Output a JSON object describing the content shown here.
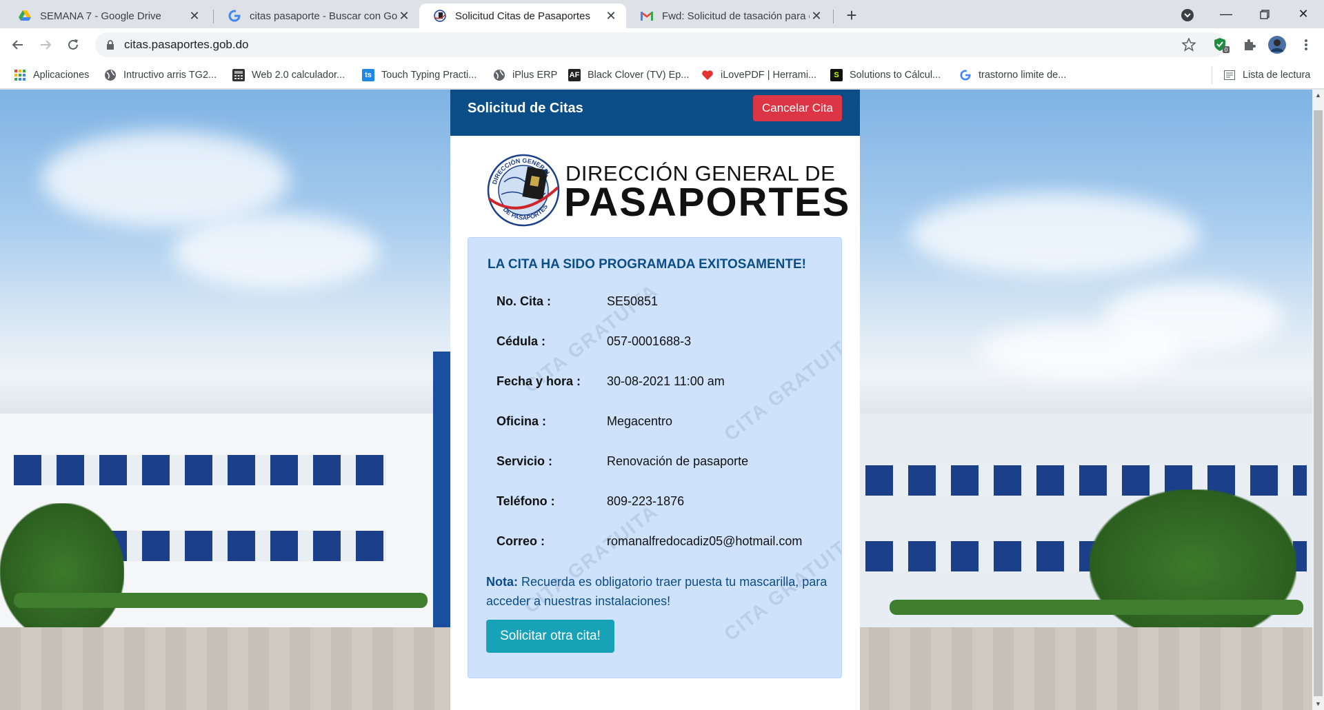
{
  "browser": {
    "tabs": [
      {
        "title": "SEMANA 7 - Google Drive",
        "icon": "google-drive-icon"
      },
      {
        "title": "citas pasaporte - Buscar con Goo",
        "icon": "google-icon"
      },
      {
        "title": "Solicitud Citas de Pasaportes",
        "icon": "passport-site-icon",
        "active": true
      },
      {
        "title": "Fwd: Solicitud de tasación para e",
        "icon": "gmail-icon"
      }
    ],
    "url": "citas.pasaportes.gob.do",
    "bookmarks": [
      {
        "label": "Aplicaciones",
        "icon": "apps-grid-icon"
      },
      {
        "label": "Intructivo arris TG2...",
        "icon": "globe-icon"
      },
      {
        "label": "Web 2.0 calculador...",
        "icon": "calculator-icon"
      },
      {
        "label": "Touch Typing Practi...",
        "icon": "ts-icon",
        "icon_text": "ts"
      },
      {
        "label": "iPlus ERP",
        "icon": "globe-icon"
      },
      {
        "label": "Black Clover (TV) Ep...",
        "icon": "af-icon",
        "icon_text": "AF"
      },
      {
        "label": "iLovePDF | Herrami...",
        "icon": "heart-icon"
      },
      {
        "label": "Solutions to Cálcul...",
        "icon": "s-icon",
        "icon_text": "S"
      },
      {
        "label": "trastorno limite de...",
        "icon": "google-icon"
      }
    ],
    "reading_list": "Lista de lectura",
    "extension_badge": "0"
  },
  "card": {
    "title": "Solicitud de Citas",
    "cancel_label": "Cancelar Cita",
    "logo": {
      "line1": "DIRECCIÓN GENERAL DE",
      "line2": "PASAPORTES",
      "seal_text_top": "DIRECCIÓN GENERAL",
      "seal_text_bottom": "DE PASAPORTES"
    },
    "success_message": "LA CITA HA SIDO PROGRAMADA EXITOSAMENTE!",
    "details": [
      {
        "label": "No. Cita :",
        "value": "SE50851"
      },
      {
        "label": "Cédula :",
        "value": "057-0001688-3"
      },
      {
        "label": "Fecha y hora :",
        "value": "30-08-2021 11:00 am"
      },
      {
        "label": "Oficina :",
        "value": "Megacentro"
      },
      {
        "label": "Servicio :",
        "value": "Renovación de pasaporte"
      },
      {
        "label": "Teléfono :",
        "value": "809-223-1876"
      },
      {
        "label": "Correo :",
        "value": "romanalfredocadiz05@hotmail.com"
      }
    ],
    "note_label": "Nota:",
    "note_text": " Recuerda es obligatorio traer puesta tu mascarilla, para acceder a nuestras instalaciones!",
    "again_label": "Solicitar otra cita!",
    "watermark": "CITA GRATUITA",
    "colors": {
      "header": "#0b4d86",
      "cancel": "#dc3545",
      "again": "#17a2b8",
      "box": "#cfe2fb"
    }
  }
}
